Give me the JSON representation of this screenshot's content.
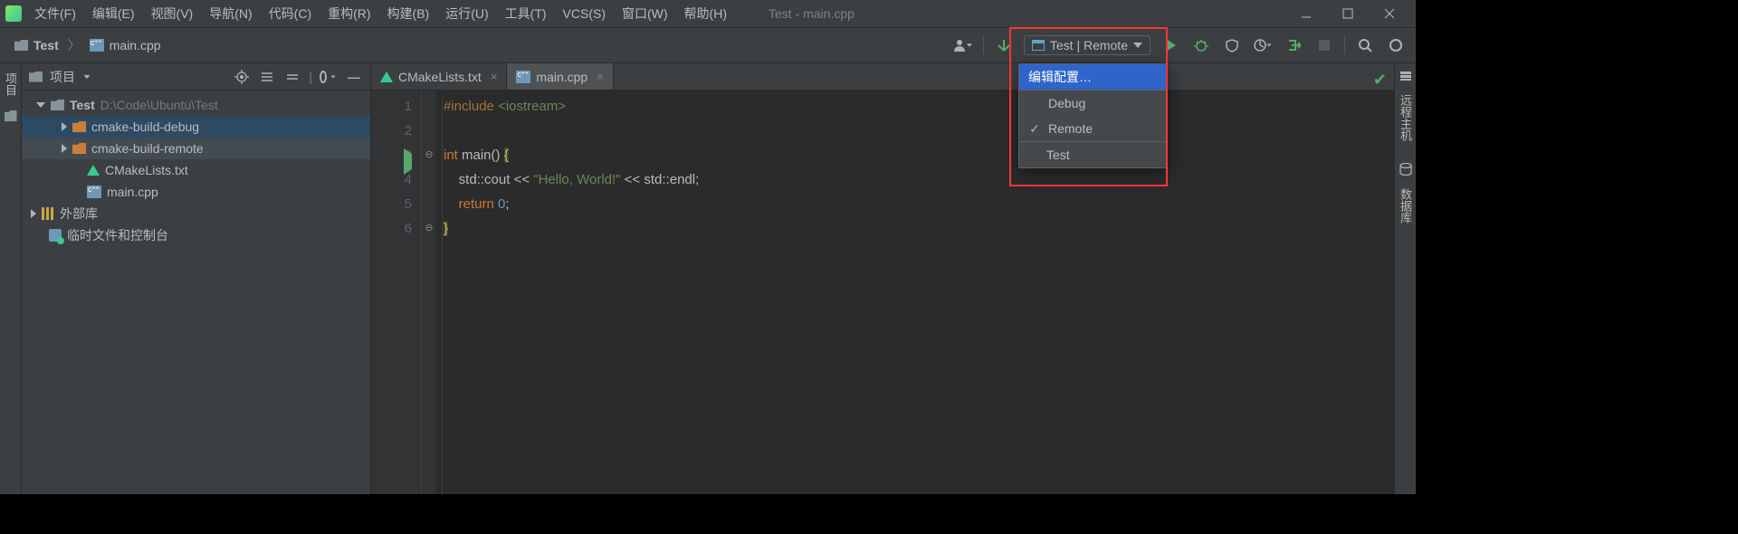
{
  "menu": {
    "items": [
      "文件(F)",
      "编辑(E)",
      "视图(V)",
      "导航(N)",
      "代码(C)",
      "重构(R)",
      "构建(B)",
      "运行(U)",
      "工具(T)",
      "VCS(S)",
      "窗口(W)",
      "帮助(H)"
    ],
    "title": "Test - main.cpp"
  },
  "breadcrumb": {
    "root": "Test",
    "file": "main.cpp"
  },
  "run_config": {
    "label": "Test | Remote"
  },
  "dropdown": {
    "edit": "编辑配置…",
    "items": [
      {
        "label": "Debug",
        "checked": false
      },
      {
        "label": "Remote",
        "checked": true
      },
      {
        "label": "Test",
        "checked": false,
        "app": true
      }
    ]
  },
  "left_strip": {
    "label": "项目"
  },
  "right_strip": {
    "label1": "远程主机",
    "label2": "数据库"
  },
  "project_panel": {
    "title": "项目",
    "root": {
      "name": "Test",
      "path": "D:\\Code\\Ubuntu\\Test"
    },
    "children": [
      {
        "name": "cmake-build-debug",
        "kind": "folder",
        "selected": true
      },
      {
        "name": "cmake-build-remote",
        "kind": "folder"
      },
      {
        "name": "CMakeLists.txt",
        "kind": "cmake"
      },
      {
        "name": "main.cpp",
        "kind": "cpp"
      }
    ],
    "extra": [
      {
        "name": "外部库",
        "kind": "lib"
      },
      {
        "name": "临时文件和控制台",
        "kind": "scratch"
      }
    ]
  },
  "tabs": [
    {
      "name": "CMakeLists.txt",
      "kind": "cmake",
      "active": false
    },
    {
      "name": "main.cpp",
      "kind": "cpp",
      "active": true
    }
  ],
  "code": {
    "lines": [
      {
        "n": 1,
        "html": "<span class='inc'>#include</span> <span class='str'>&lt;iostream&gt;</span>"
      },
      {
        "n": 2,
        "html": ""
      },
      {
        "n": 3,
        "html": "<span class='kw'>int</span> <span class='ns'>main</span>() <span class='br mhl'>{</span>",
        "run": true,
        "fold": "⊖"
      },
      {
        "n": 4,
        "html": "    <span class='ns'>std</span>::<span class='ns'>cout</span> <span class='op'>&lt;&lt;</span> <span class='str'>\"Hello, World!\"</span> <span class='op'>&lt;&lt;</span> <span class='ns'>std</span>::<span class='ns'>endl</span>;"
      },
      {
        "n": 5,
        "html": "    <span class='kw'>return</span> <span class='num'>0</span>;"
      },
      {
        "n": 6,
        "html": "<span class='br mhl'>}</span>",
        "fold": "⊖"
      }
    ]
  }
}
